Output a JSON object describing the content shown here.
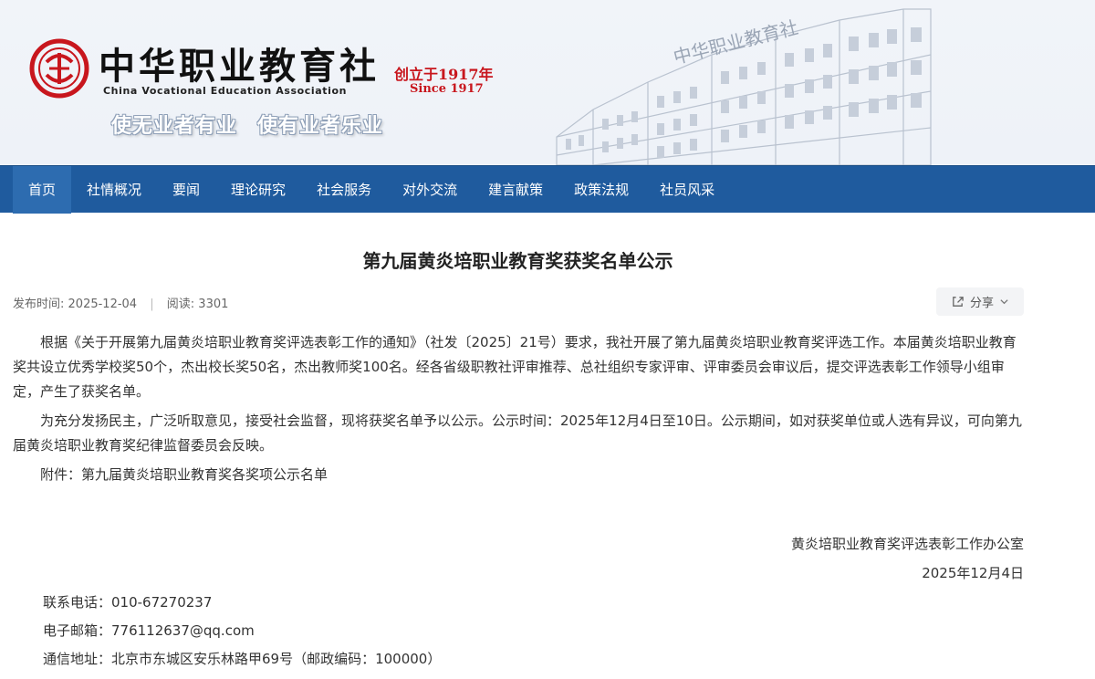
{
  "header": {
    "logo_cn": "中华职业教育社",
    "logo_en": "China Vocational Education Association",
    "founded_cn": "创立于1917年",
    "founded_en": "Since 1917",
    "slogan_1": "使无业者有业",
    "slogan_2": "使有业者乐业",
    "building_sign": "中华职业教育社",
    "brand_red": "#c8161d"
  },
  "nav": {
    "items": [
      "首页",
      "社情概况",
      "要闻",
      "理论研究",
      "社会服务",
      "对外交流",
      "建言献策",
      "政策法规",
      "社员风采"
    ],
    "active_index": 0,
    "bar_color": "#1f5b9e",
    "active_color": "#2d6cb0"
  },
  "article": {
    "title": "第九届黄炎培职业教育奖获奖名单公示",
    "publish_label": "发布时间:",
    "publish_date": "2025-12-04",
    "read_label": "阅读:",
    "read_count": "3301",
    "share_label": "分享",
    "share_icon": "share-icon",
    "paragraphs": [
      "根据《关于开展第九届黄炎培职业教育奖评选表彰工作的通知》（社发〔2025〕21号）要求，我社开展了第九届黄炎培职业教育奖评选工作。本届黄炎培职业教育奖共设立优秀学校奖50个，杰出校长奖50名，杰出教师奖100名。经各省级职教社评审推荐、总社组织专家评审、评审委员会审议后，提交评选表彰工作领导小组审定，产生了获奖名单。",
      "为充分发扬民主，广泛听取意见，接受社会监督，现将获奖名单予以公示。公示时间：2025年12月4日至10日。公示期间，如对获奖单位或人选有异议，可向第九届黄炎培职业教育奖纪律监督委员会反映。",
      "附件：第九届黄炎培职业教育奖各奖项公示名单"
    ],
    "signature_org": "黄炎培职业教育奖评选表彰工作办公室",
    "signature_date": "2025年12月4日",
    "contact_phone": "联系电话：010-67270237",
    "contact_email": "电子邮箱：776112637@qq.com",
    "contact_address": "通信地址：北京市东城区安乐林路甲69号（邮政编码：100000）"
  }
}
